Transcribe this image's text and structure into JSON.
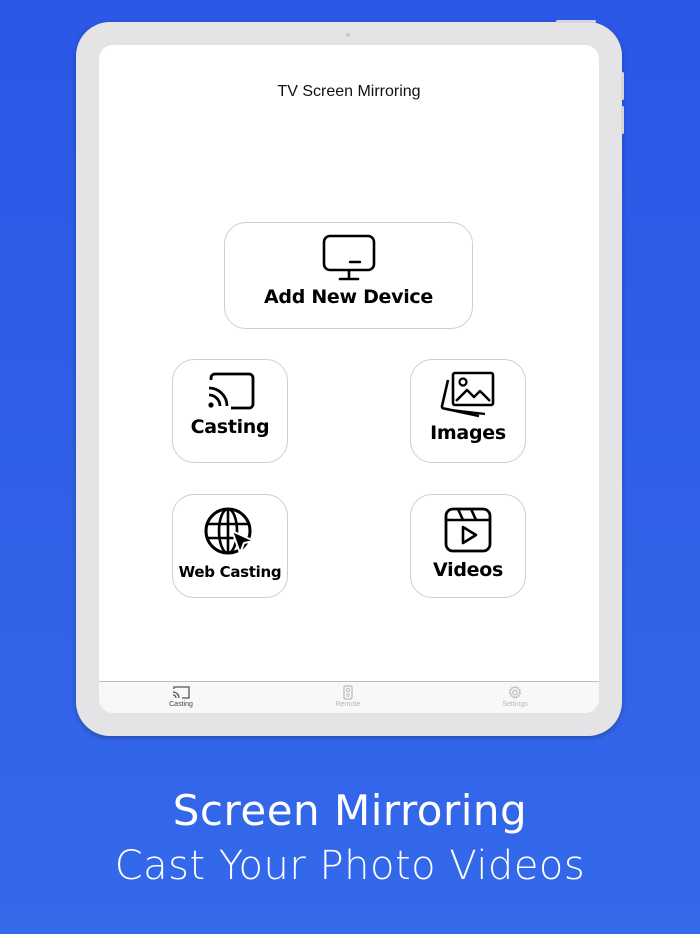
{
  "app": {
    "title": "TV Screen Mirroring"
  },
  "cards": {
    "add_device": {
      "label": "Add New Device",
      "icon": "monitor-icon"
    },
    "casting": {
      "label": "Casting",
      "icon": "cast-icon"
    },
    "images": {
      "label": "Images",
      "icon": "images-icon"
    },
    "web_casting": {
      "label": "Web Casting",
      "icon": "globe-cursor-icon"
    },
    "videos": {
      "label": "Videos",
      "icon": "video-icon"
    }
  },
  "tabbar": {
    "items": [
      {
        "label": "Casting",
        "icon": "cast-icon",
        "active": true
      },
      {
        "label": "Remote",
        "icon": "remote-icon",
        "active": false
      },
      {
        "label": "Settings",
        "icon": "gear-icon",
        "active": false
      }
    ]
  },
  "promo": {
    "line1": "Screen Mirroring",
    "line2": "Cast Your Photo Videos"
  },
  "colors": {
    "background": "#2b57e6",
    "tablet_frame": "#e4e4e6",
    "card_border": "#cfcfcf"
  }
}
